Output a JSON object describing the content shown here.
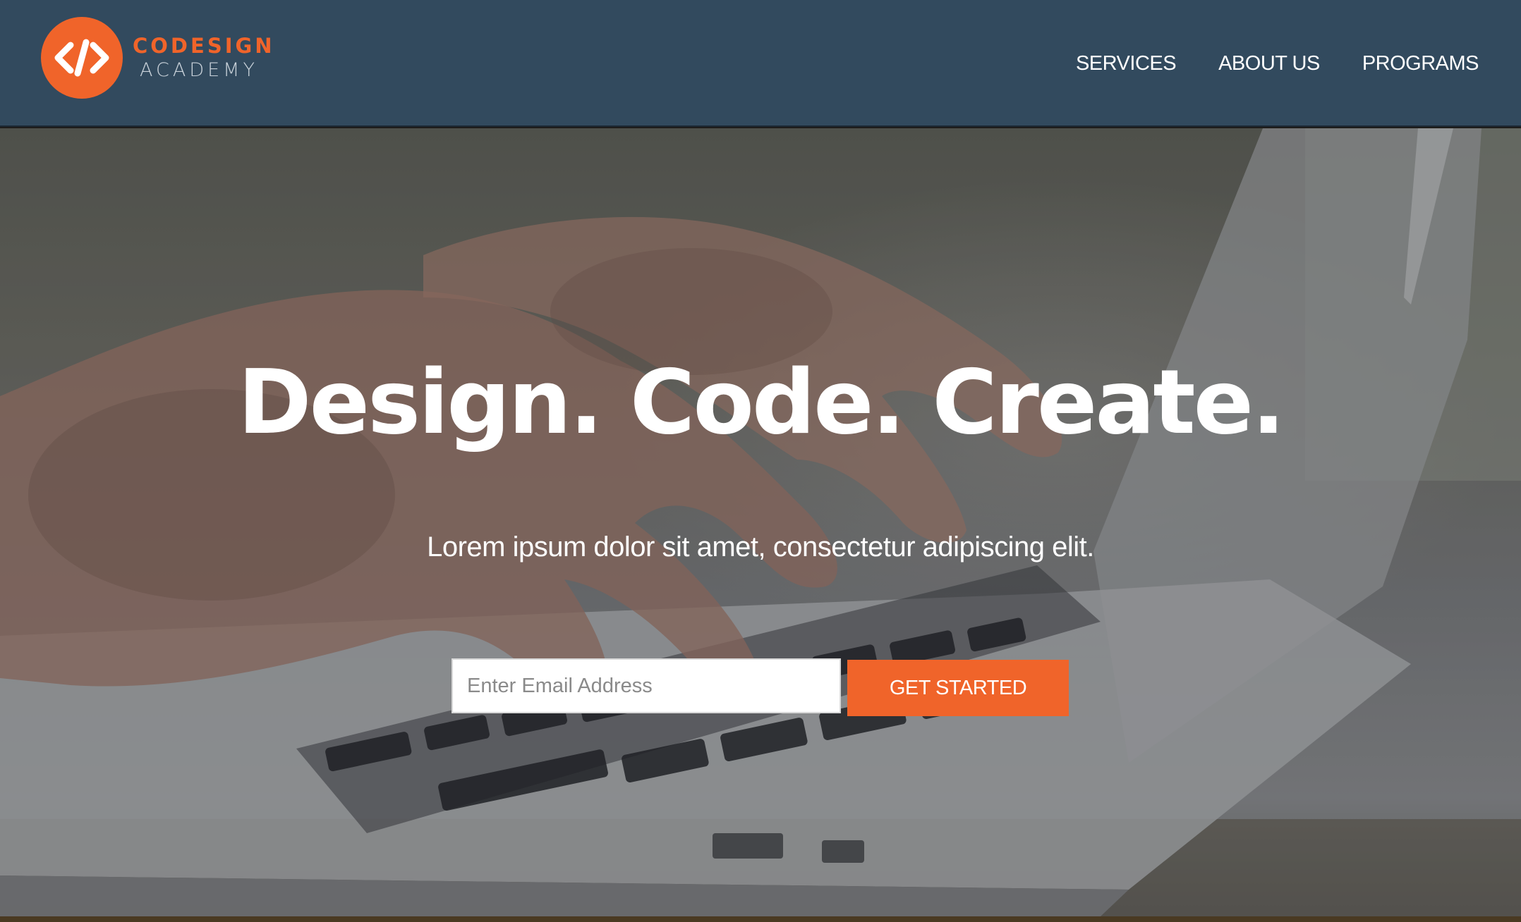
{
  "brand": {
    "name_line1": "CODESIGN",
    "name_line2": "ACADEMY",
    "logo_glyph": "</>",
    "accent_color": "#f0642a",
    "header_color": "#324a5e"
  },
  "nav": {
    "items": [
      {
        "label": "SERVICES"
      },
      {
        "label": "ABOUT US"
      },
      {
        "label": "PROGRAMS"
      }
    ]
  },
  "hero": {
    "title": "Design. Code. Create.",
    "subtitle": "Lorem ipsum dolor sit amet, consectetur adipiscing elit.",
    "email_placeholder": "Enter Email Address",
    "email_value": "",
    "cta_label": "GET STARTED",
    "background_image": "hands-typing-on-laptop-photo"
  },
  "icons": {
    "logo": "code-brackets-icon"
  }
}
